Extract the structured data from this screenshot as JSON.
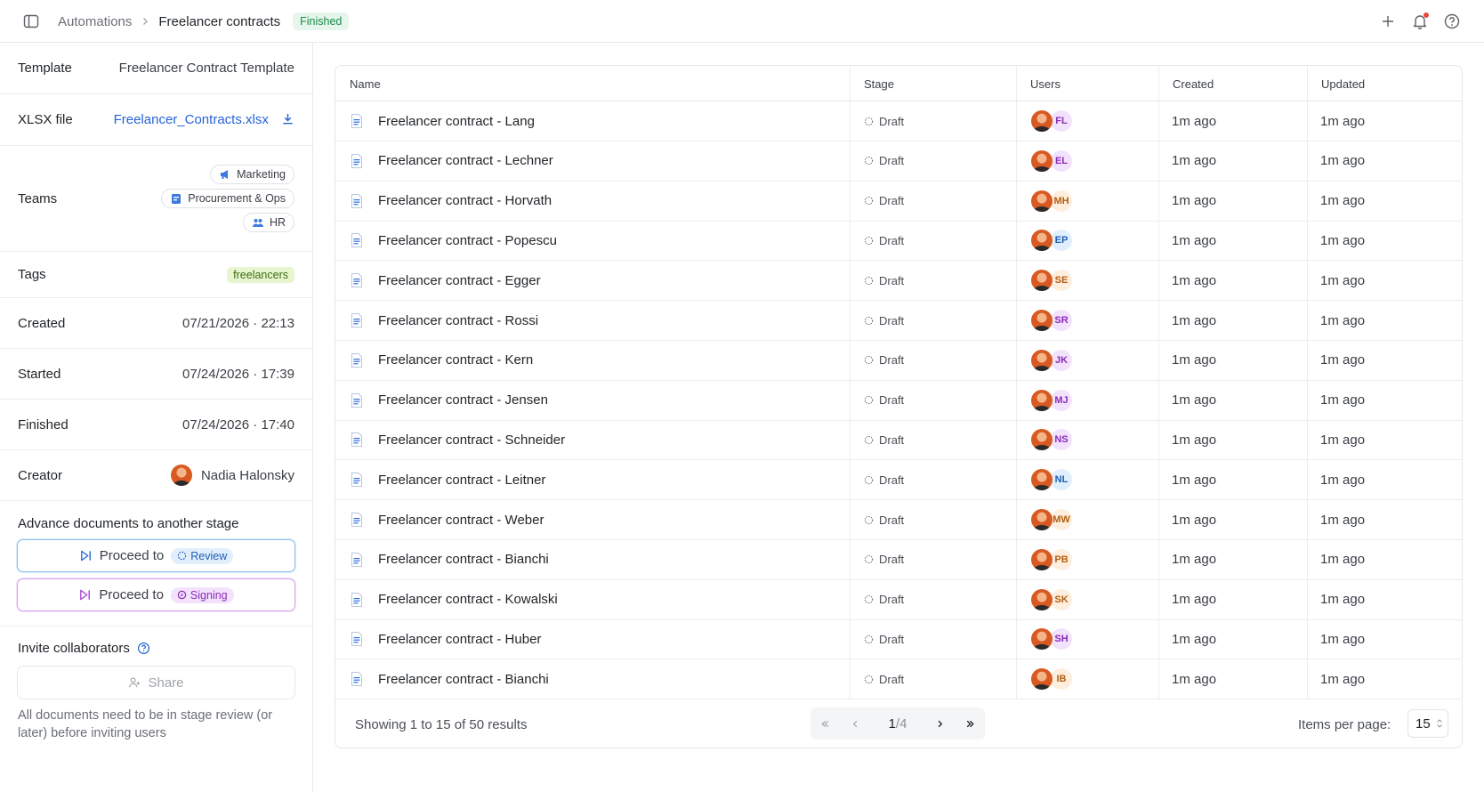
{
  "breadcrumb": {
    "parent": "Automations",
    "current": "Freelancer contracts",
    "status": "Finished"
  },
  "details": {
    "template": {
      "label": "Template",
      "value": "Freelancer Contract Template"
    },
    "xlsx": {
      "label": "XLSX file",
      "value": "Freelancer_Contracts.xlsx"
    },
    "teams": {
      "label": "Teams",
      "items": [
        "Marketing",
        "Procurement & Ops",
        "HR"
      ]
    },
    "tags": {
      "label": "Tags",
      "items": [
        "freelancers"
      ]
    },
    "created": {
      "label": "Created",
      "value": "07/21/2026 · 22:13"
    },
    "started": {
      "label": "Started",
      "value": "07/24/2026 · 17:39"
    },
    "finished": {
      "label": "Finished",
      "value": "07/24/2026 · 17:40"
    },
    "creator": {
      "label": "Creator",
      "value": "Nadia Halonsky"
    }
  },
  "advance": {
    "title": "Advance documents to another stage",
    "proceed_label": "Proceed to",
    "review_stage": "Review",
    "signing_stage": "Signing"
  },
  "invite": {
    "title": "Invite collaborators",
    "share_label": "Share",
    "note": "All documents need to be in stage review (or later) before inviting users"
  },
  "table": {
    "columns": [
      "Name",
      "Stage",
      "Users",
      "Created",
      "Updated"
    ],
    "rows": [
      {
        "name": "Freelancer contract - Lang",
        "stage": "Draft",
        "initials": "FL",
        "bg": "#f3e2fc",
        "fg": "#8a2cb8",
        "created": "1m ago",
        "updated": "1m ago"
      },
      {
        "name": "Freelancer contract - Lechner",
        "stage": "Draft",
        "initials": "EL",
        "bg": "#f3e2fc",
        "fg": "#8a2cb8",
        "created": "1m ago",
        "updated": "1m ago"
      },
      {
        "name": "Freelancer contract - Horvath",
        "stage": "Draft",
        "initials": "MH",
        "bg": "#fdeedd",
        "fg": "#b25f12",
        "created": "1m ago",
        "updated": "1m ago"
      },
      {
        "name": "Freelancer contract - Popescu",
        "stage": "Draft",
        "initials": "EP",
        "bg": "#e1effd",
        "fg": "#1d5fb5",
        "created": "1m ago",
        "updated": "1m ago"
      },
      {
        "name": "Freelancer contract - Egger",
        "stage": "Draft",
        "initials": "SE",
        "bg": "#fdeedd",
        "fg": "#b25f12",
        "created": "1m ago",
        "updated": "1m ago"
      },
      {
        "name": "Freelancer contract - Rossi",
        "stage": "Draft",
        "initials": "SR",
        "bg": "#f3e2fc",
        "fg": "#8a2cb8",
        "created": "1m ago",
        "updated": "1m ago"
      },
      {
        "name": "Freelancer contract - Kern",
        "stage": "Draft",
        "initials": "JK",
        "bg": "#f3e2fc",
        "fg": "#8a2cb8",
        "created": "1m ago",
        "updated": "1m ago"
      },
      {
        "name": "Freelancer contract - Jensen",
        "stage": "Draft",
        "initials": "MJ",
        "bg": "#f3e2fc",
        "fg": "#8a2cb8",
        "created": "1m ago",
        "updated": "1m ago"
      },
      {
        "name": "Freelancer contract - Schneider",
        "stage": "Draft",
        "initials": "NS",
        "bg": "#f3e2fc",
        "fg": "#8a2cb8",
        "created": "1m ago",
        "updated": "1m ago"
      },
      {
        "name": "Freelancer contract - Leitner",
        "stage": "Draft",
        "initials": "NL",
        "bg": "#e1effd",
        "fg": "#1d5fb5",
        "created": "1m ago",
        "updated": "1m ago"
      },
      {
        "name": "Freelancer contract - Weber",
        "stage": "Draft",
        "initials": "MW",
        "bg": "#fdeedd",
        "fg": "#b25f12",
        "created": "1m ago",
        "updated": "1m ago"
      },
      {
        "name": "Freelancer contract - Bianchi",
        "stage": "Draft",
        "initials": "PB",
        "bg": "#fdeedd",
        "fg": "#b25f12",
        "created": "1m ago",
        "updated": "1m ago"
      },
      {
        "name": "Freelancer contract - Kowalski",
        "stage": "Draft",
        "initials": "SK",
        "bg": "#fdeedd",
        "fg": "#b25f12",
        "created": "1m ago",
        "updated": "1m ago"
      },
      {
        "name": "Freelancer contract - Huber",
        "stage": "Draft",
        "initials": "SH",
        "bg": "#f3e2fc",
        "fg": "#8a2cb8",
        "created": "1m ago",
        "updated": "1m ago"
      },
      {
        "name": "Freelancer contract - Bianchi",
        "stage": "Draft",
        "initials": "IB",
        "bg": "#fdeedd",
        "fg": "#b25f12",
        "created": "1m ago",
        "updated": "1m ago"
      }
    ]
  },
  "pagination": {
    "summary": "Showing 1 to 15 of 50 results",
    "page": "1",
    "total_pages": "/4",
    "items_per_page_label": "Items per page:",
    "items_per_page": "15"
  },
  "icons": {
    "sidebar_toggle": "sidebar-toggle-icon",
    "plus": "plus-icon",
    "bell": "bell-icon",
    "help": "help-circle-icon",
    "document": "document-icon"
  },
  "colors": {
    "accent": "#2463d9",
    "finished_bg": "#e6f6ec",
    "finished_fg": "#1b8a48",
    "notification": "#e5483d"
  }
}
